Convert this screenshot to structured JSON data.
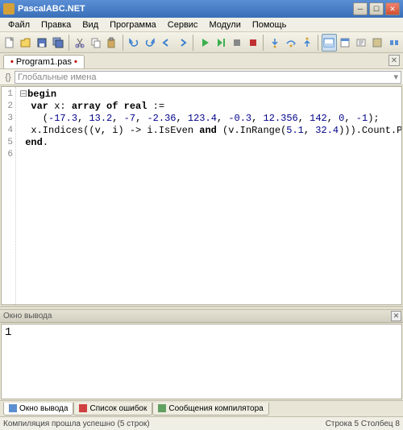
{
  "window": {
    "title": "PascalABC.NET"
  },
  "menu": [
    "Файл",
    "Правка",
    "Вид",
    "Программа",
    "Сервис",
    "Модули",
    "Помощь"
  ],
  "tabs": [
    {
      "label": "Program1.pas",
      "dirty": "•"
    }
  ],
  "nav": {
    "placeholder": "Глобальные имена"
  },
  "code": {
    "lines": [
      "1",
      "2",
      "3",
      "4",
      "5",
      "6"
    ],
    "l1_kw1": "begin",
    "l2_kw1": "var",
    "l2_id": " x: ",
    "l2_kw2": "array of ",
    "l2_ty": "real",
    "l2_op": " :=",
    "l3a": "    (",
    "l3n1": "-17.3",
    "l3c1": ", ",
    "l3n2": "13.2",
    "l3c2": ", ",
    "l3n3": "-7",
    "l3c3": ", ",
    "l3n4": "-2.36",
    "l3c4": ", ",
    "l3n5": "123.4",
    "l3c5": ", ",
    "l3n6": "-0.3",
    "l3c6": ", ",
    "l3n7": "12.356",
    "l3c7": ", ",
    "l3n8": "142",
    "l3c8": ", ",
    "l3n9": "0",
    "l3c9": ", ",
    "l3n10": "-1",
    "l3b": ");",
    "l4a": "  x.Indices((v, i) -> i.IsEven ",
    "l4kw": "and",
    "l4b": " (v.InRange(",
    "l4n1": "5.1",
    "l4c": ", ",
    "l4n2": "32.4",
    "l4d": "))).Count.Print",
    "l5_kw": "end",
    "l5_dot": "."
  },
  "outputPanel": {
    "title": "Окно вывода",
    "content": "1"
  },
  "bottomTabs": [
    {
      "label": "Окно вывода",
      "icon": "#5b8fd0"
    },
    {
      "label": "Список ошибок",
      "icon": "#d04040"
    },
    {
      "label": "Сообщения компилятора",
      "icon": "#60a060"
    }
  ],
  "status": {
    "left": "Компиляция прошла успешно (5 строк)",
    "right": "Строка  5 Столбец   8"
  }
}
